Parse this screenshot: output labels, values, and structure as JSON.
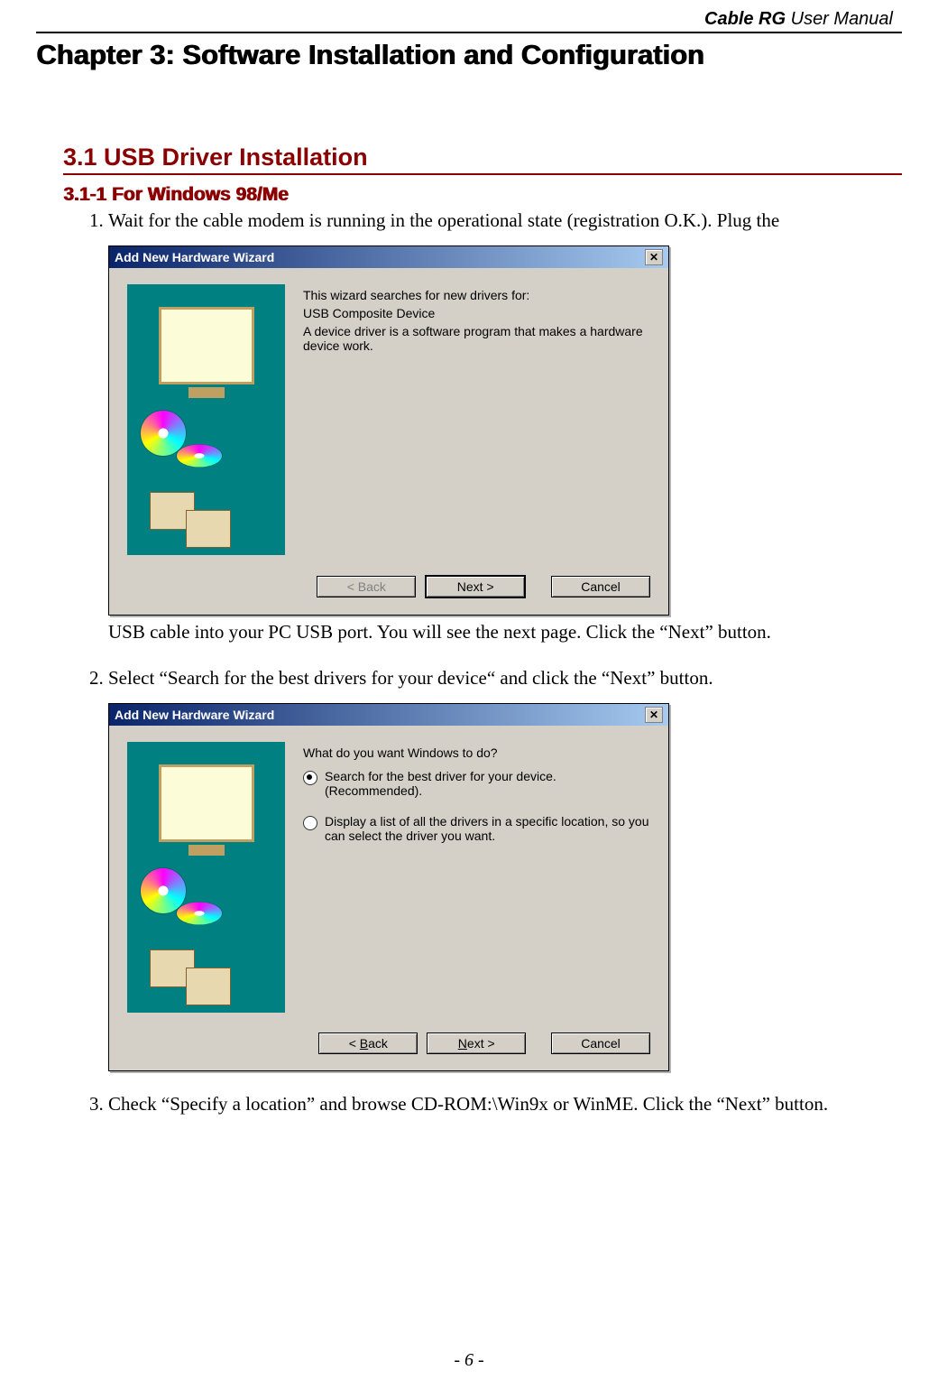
{
  "header": {
    "brand": "Cable RG",
    "suffix": " User Manual"
  },
  "chapter_title": "Chapter 3: Software Installation and Configuration",
  "section_title": "3.1 USB Driver Installation",
  "sub_title": "3.1-1 For Windows 98/Me",
  "steps": {
    "s1a": "Wait for the cable modem is running in the operational state (registration O.K.). Plug the",
    "s1b": "USB cable into your PC USB port. You will see the next page. Click the “Next” button.",
    "s2": "Select “Search for the best drivers for your device“ and click the “Next” button.",
    "s3": "Check “Specify a location” and browse CD-ROM:\\Win9x or WinME. Click the “Next” button."
  },
  "wiz1": {
    "title": "Add New Hardware Wizard",
    "line1": "This wizard searches for new drivers for:",
    "device": "USB Composite Device",
    "line2": "A device driver is a software program that makes a hardware device work.",
    "back": "< Back",
    "next": "Next >",
    "cancel": "Cancel"
  },
  "wiz2": {
    "title": "Add New Hardware Wizard",
    "prompt": "What do you want Windows to do?",
    "opt1": "Search for the best driver for your device. (Recommended).",
    "opt2": "Display a list of all the drivers in a specific location, so you can select the driver you want.",
    "back_pre": "< ",
    "back_u": "B",
    "back_post": "ack",
    "next_pre": "",
    "next_u": "N",
    "next_post": "ext >",
    "cancel": "Cancel"
  },
  "footer": "- 6 -"
}
